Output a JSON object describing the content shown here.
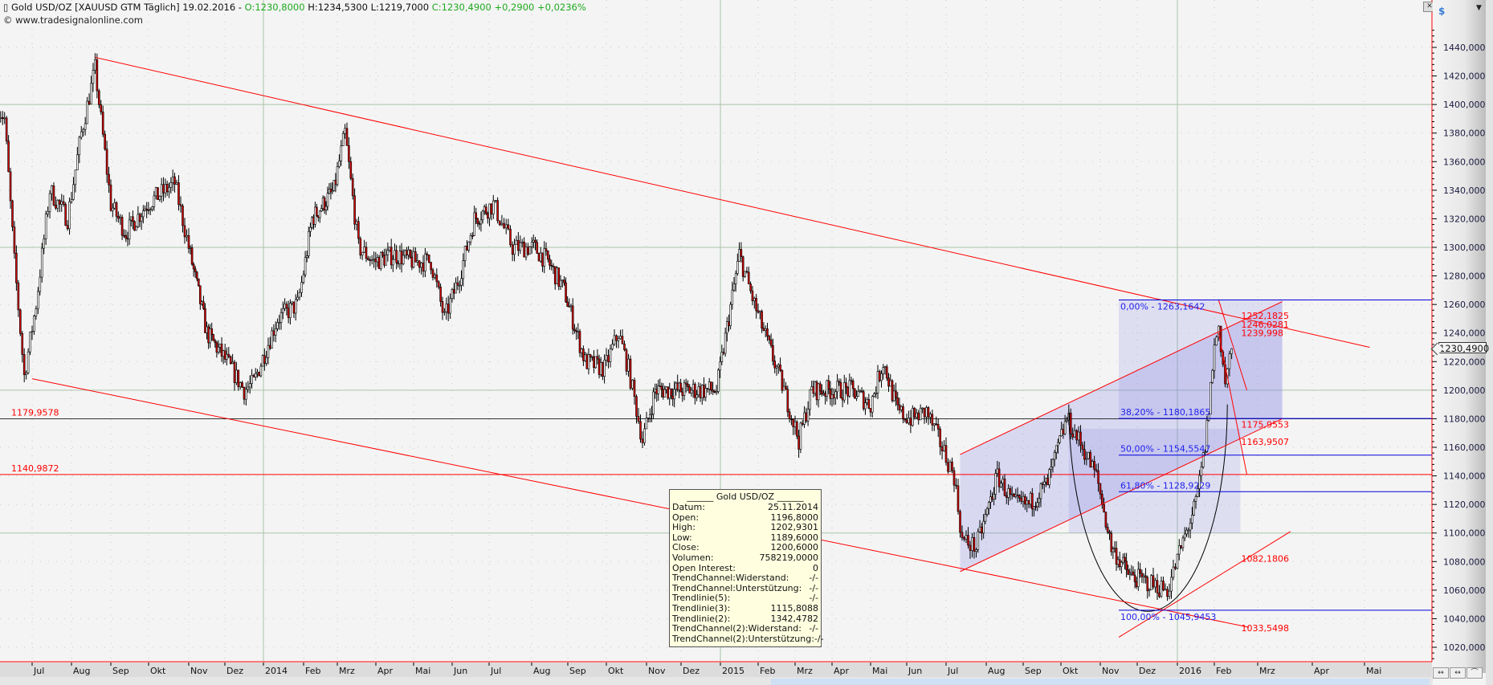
{
  "header": {
    "symbol_icon": "candlestick-icon",
    "title": "Gold USD/OZ [XAUUSD GTM  Täglich]",
    "date": "19.02.2016 -",
    "open": "O:1230,8000",
    "high": "H:1234,5300",
    "low": "L:1219,7000",
    "close": "C:1230,4900",
    "change": "+0,2900",
    "change_pct": "+0,0236%",
    "copyright": "© www.tradesignalonline.com"
  },
  "axis": {
    "currency": "$",
    "current_price": "1230,4900",
    "buttons": [
      "↔",
      "↔",
      "⌒"
    ]
  },
  "colors": {
    "up": "#ffffff",
    "down": "#d40000",
    "trend": "#ff0000",
    "fib": "#0000dd",
    "grid_major": "#a8c8a8"
  },
  "tooltip": {
    "title": "______ Gold USD/OZ ______",
    "rows": [
      {
        "k": "Datum:",
        "v": "25.11.2014"
      },
      {
        "k": "Open:",
        "v": "1196,8000"
      },
      {
        "k": "High:",
        "v": "1202,9301"
      },
      {
        "k": "Low:",
        "v": "1189,6000"
      },
      {
        "k": "Close:",
        "v": "1200,6000"
      },
      {
        "k": "Volumen:",
        "v": "758219,0000"
      },
      {
        "k": "Open Interest:",
        "v": "0"
      },
      {
        "k": "TrendChannel:Widerstand:",
        "v": "-/-"
      },
      {
        "k": "TrendChannel:Unterstützung:",
        "v": "-/-"
      },
      {
        "k": "Trendlinie(5):",
        "v": "-/-"
      },
      {
        "k": "Trendlinie(3):",
        "v": "1115,8088"
      },
      {
        "k": "Trendlinie(2):",
        "v": "1342,4782"
      },
      {
        "k": "TrendChannel(2):Widerstand:",
        "v": "-/-"
      },
      {
        "k": "TrendChannel(2):Unterstützung:",
        "v": "-/-"
      }
    ]
  },
  "chart_data": {
    "type": "candlestick",
    "title": "Gold USD/OZ",
    "ylim": [
      1010,
      1453
    ],
    "y_ticks": [
      "1440,0000",
      "1420,0000",
      "1400,0000",
      "1380,0000",
      "1360,0000",
      "1340,0000",
      "1320,0000",
      "1300,0000",
      "1280,0000",
      "1260,0000",
      "1240,0000",
      "1220,0000",
      "1200,0000",
      "1180,0000",
      "1160,0000",
      "1140,0000",
      "1120,0000",
      "1100,0000",
      "1080,0000",
      "1060,0000",
      "1040,0000",
      "1020,0000"
    ],
    "x_labels": [
      "Jul",
      "Aug",
      "Sep",
      "Okt",
      "Nov",
      "Dez",
      "2014",
      "Feb",
      "Mrz",
      "Apr",
      "Mai",
      "Jun",
      "Jul",
      "Aug",
      "Sep",
      "Okt",
      "Nov",
      "Dez",
      "2015",
      "Feb",
      "Mrz",
      "Apr",
      "Mai",
      "Jun",
      "Jul",
      "Aug",
      "Sep",
      "Okt",
      "Nov",
      "Dez",
      "2016",
      "Feb",
      "Mrz",
      "Apr",
      "Mai"
    ],
    "price_path_month_price": [
      [
        -0.9,
        1400
      ],
      [
        -0.7,
        1390
      ],
      [
        -0.45,
        1290
      ],
      [
        -0.2,
        1210
      ],
      [
        0.1,
        1260
      ],
      [
        0.45,
        1340
      ],
      [
        0.9,
        1320
      ],
      [
        1.25,
        1380
      ],
      [
        1.6,
        1425
      ],
      [
        2,
        1330
      ],
      [
        2.4,
        1310
      ],
      [
        2.95,
        1330
      ],
      [
        3.65,
        1345
      ],
      [
        4,
        1300
      ],
      [
        4.5,
        1240
      ],
      [
        5.05,
        1220
      ],
      [
        5.5,
        1200
      ],
      [
        5.75,
        1205
      ],
      [
        6.35,
        1250
      ],
      [
        6.85,
        1260
      ],
      [
        7.25,
        1320
      ],
      [
        7.9,
        1340
      ],
      [
        8.2,
        1380
      ],
      [
        8.55,
        1300
      ],
      [
        8.95,
        1290
      ],
      [
        9.5,
        1295
      ],
      [
        10,
        1290
      ],
      [
        10.45,
        1290
      ],
      [
        10.8,
        1250
      ],
      [
        11.2,
        1280
      ],
      [
        11.6,
        1320
      ],
      [
        12.1,
        1330
      ],
      [
        12.55,
        1300
      ],
      [
        13.05,
        1300
      ],
      [
        13.45,
        1290
      ],
      [
        13.9,
        1270
      ],
      [
        14.45,
        1220
      ],
      [
        14.95,
        1215
      ],
      [
        15.3,
        1240
      ],
      [
        15.55,
        1215
      ],
      [
        15.9,
        1165
      ],
      [
        16.25,
        1200
      ],
      [
        16.9,
        1200
      ],
      [
        17.4,
        1200
      ],
      [
        17.9,
        1200
      ],
      [
        18.5,
        1295
      ],
      [
        18.9,
        1260
      ],
      [
        19.3,
        1230
      ],
      [
        19.7,
        1200
      ],
      [
        20.1,
        1165
      ],
      [
        20.45,
        1200
      ],
      [
        21,
        1200
      ],
      [
        21.5,
        1200
      ],
      [
        22,
        1190
      ],
      [
        22.35,
        1220
      ],
      [
        22.75,
        1185
      ],
      [
        23.1,
        1180
      ],
      [
        23.5,
        1185
      ],
      [
        23.9,
        1160
      ],
      [
        24.2,
        1140
      ],
      [
        24.4,
        1095
      ],
      [
        24.75,
        1090
      ],
      [
        25.3,
        1140
      ],
      [
        25.75,
        1120
      ],
      [
        26.15,
        1120
      ],
      [
        26.65,
        1135
      ],
      [
        27.15,
        1180
      ],
      [
        27.55,
        1160
      ],
      [
        27.9,
        1140
      ],
      [
        28.3,
        1090
      ],
      [
        28.8,
        1070
      ],
      [
        29.3,
        1065
      ],
      [
        29.75,
        1060
      ],
      [
        30.1,
        1090
      ],
      [
        30.5,
        1120
      ],
      [
        30.75,
        1160
      ],
      [
        31.0,
        1230
      ],
      [
        31.1,
        1245
      ],
      [
        31.25,
        1205
      ],
      [
        31.4,
        1230
      ]
    ],
    "horizontal_levels": [
      {
        "price": 1179.9578,
        "label": "1179,9578",
        "color": "#333333"
      },
      {
        "price": 1140.9872,
        "label": "1140,9872",
        "color": "#ff0000"
      }
    ],
    "trendlines": [
      {
        "from": [
          1.6,
          1433
        ],
        "to": [
          34.1,
          1230
        ]
      },
      {
        "from": [
          0,
          1208
        ],
        "to": [
          31.8,
          1034
        ]
      },
      {
        "from": [
          24.35,
          1073
        ],
        "to": [
          32.45,
          1180
        ]
      },
      {
        "from": [
          24.35,
          1155
        ],
        "to": [
          32.45,
          1262
        ]
      },
      {
        "from": [
          28.5,
          1027
        ],
        "to": [
          32.6,
          1101
        ]
      },
      {
        "from": [
          31.1,
          1263
        ],
        "to": [
          31.75,
          1200
        ]
      },
      {
        "from": [
          31.1,
          1240
        ],
        "to": [
          31.75,
          1141
        ]
      }
    ],
    "fibonacci": [
      {
        "price": 1263.1642,
        "label": "0,00% - 1263,1642"
      },
      {
        "price": 1180.1865,
        "label": "38,20% - 1180,1865"
      },
      {
        "price": 1154.5547,
        "label": "50,00% - 1154,5547"
      },
      {
        "price": 1128.9229,
        "label": "61,80% - 1128,9229"
      },
      {
        "price": 1045.9453,
        "label": "100,00% - 1045,9453"
      }
    ],
    "price_labels": [
      {
        "price": 1252.1825,
        "label": "1252,1825"
      },
      {
        "price": 1246.0281,
        "label": "1246,0281"
      },
      {
        "price": 1239.998,
        "label": "1239,998"
      },
      {
        "price": 1175.9553,
        "label": "1175,9553"
      },
      {
        "price": 1163.9507,
        "label": "1163,9507"
      },
      {
        "price": 1082.1806,
        "label": "1082,1806"
      },
      {
        "price": 1033.5498,
        "label": "1033,5498"
      }
    ]
  }
}
